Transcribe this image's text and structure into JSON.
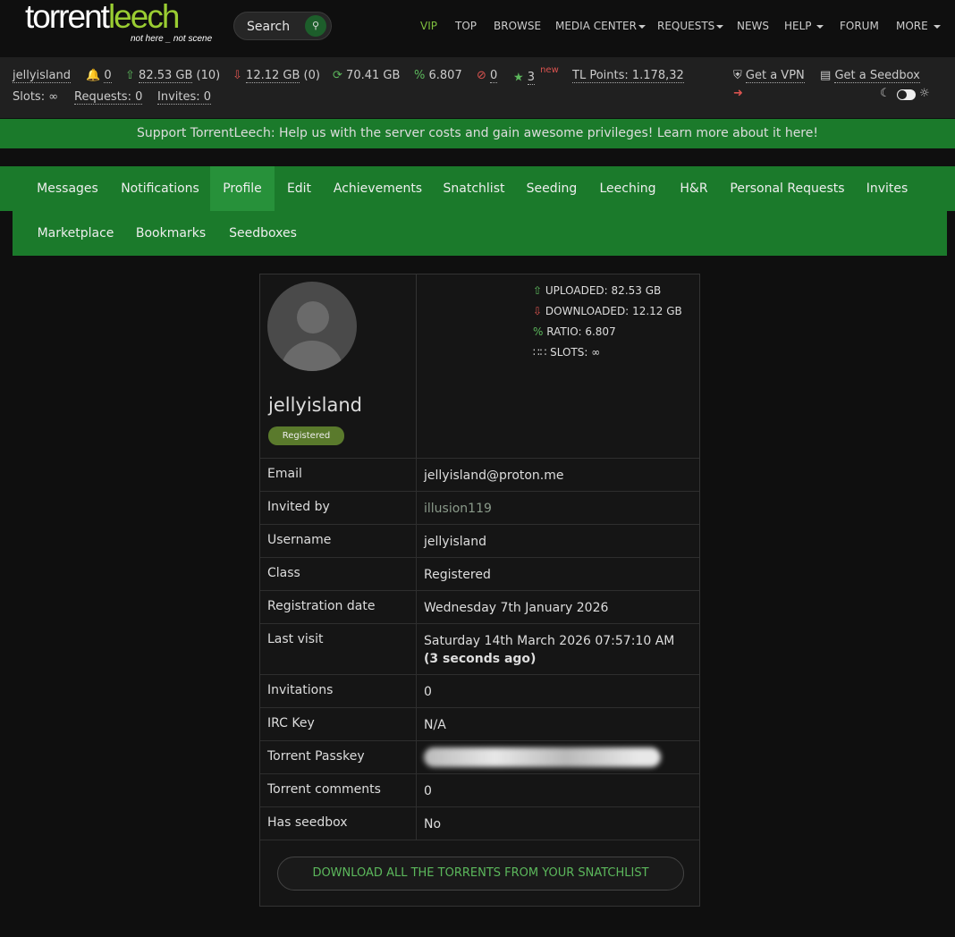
{
  "logo": {
    "part1": "torrent",
    "part2": "leech",
    "tagline": "not here _ not scene"
  },
  "search": {
    "placeholder": "Search"
  },
  "nav": {
    "vip": "VIP",
    "top": "TOP",
    "browse": "BROWSE",
    "media_center": "MEDIA CENTER",
    "requests": "REQUESTS",
    "news": "NEWS",
    "help": "HELP",
    "forum": "FORUM",
    "more": "MORE"
  },
  "stats": {
    "username": "jellyisland",
    "notifications": "0",
    "uploaded": "82.53 GB",
    "uploaded_count": "(10)",
    "downloaded": "12.12 GB",
    "downloaded_count": "(0)",
    "seedbonus": "70.41 GB",
    "ratio": "6.807",
    "hnr": "0",
    "trophies": "3",
    "trophies_new": "new",
    "tl_points": "TL Points: 1.178,32",
    "vpn": "Get a VPN",
    "seedbox": "Get a Seedbox",
    "slots_label": "Slots:",
    "slots": "∞",
    "requests": "Requests: 0",
    "invites": "Invites: 0"
  },
  "banner": "Support TorrentLeech: Help us with the server costs and gain awesome privileges! Learn more about it here!",
  "tabs": [
    "Messages",
    "Notifications",
    "Profile",
    "Edit",
    "Achievements",
    "Snatchlist",
    "Seeding",
    "Leeching",
    "H&R",
    "Personal Requests",
    "Invites"
  ],
  "tabs2": [
    "Marketplace",
    "Bookmarks",
    "Seedboxes"
  ],
  "active_tab": "Profile",
  "profile": {
    "username": "jellyisland",
    "class_badge": "Registered",
    "uploaded_label": "UPLOADED:",
    "uploaded": "82.53 GB",
    "downloaded_label": "DOWNLOADED:",
    "downloaded": "12.12 GB",
    "ratio_label": "RATIO:",
    "ratio": "6.807",
    "slots_label": "SLOTS:",
    "slots": "∞",
    "rows": [
      {
        "key": "Email",
        "value": "jellyisland@proton.me"
      },
      {
        "key": "Invited by",
        "value": "illusion119"
      },
      {
        "key": "Username",
        "value": "jellyisland"
      },
      {
        "key": "Class",
        "value": "Registered"
      },
      {
        "key": "Registration date",
        "value": "Wednesday 7th January 2026"
      },
      {
        "key": "Last visit",
        "value": "Saturday 14th March 2026 07:57:10 AM",
        "extra": "(3 seconds ago)"
      },
      {
        "key": "Invitations",
        "value": "0"
      },
      {
        "key": "IRC Key",
        "value": "N/A"
      },
      {
        "key": "Torrent Passkey",
        "value": ""
      },
      {
        "key": "Torrent comments",
        "value": "0"
      },
      {
        "key": "Has seedbox",
        "value": "No"
      }
    ],
    "download_button": "DOWNLOAD ALL THE TORRENTS FROM YOUR SNATCHLIST"
  }
}
